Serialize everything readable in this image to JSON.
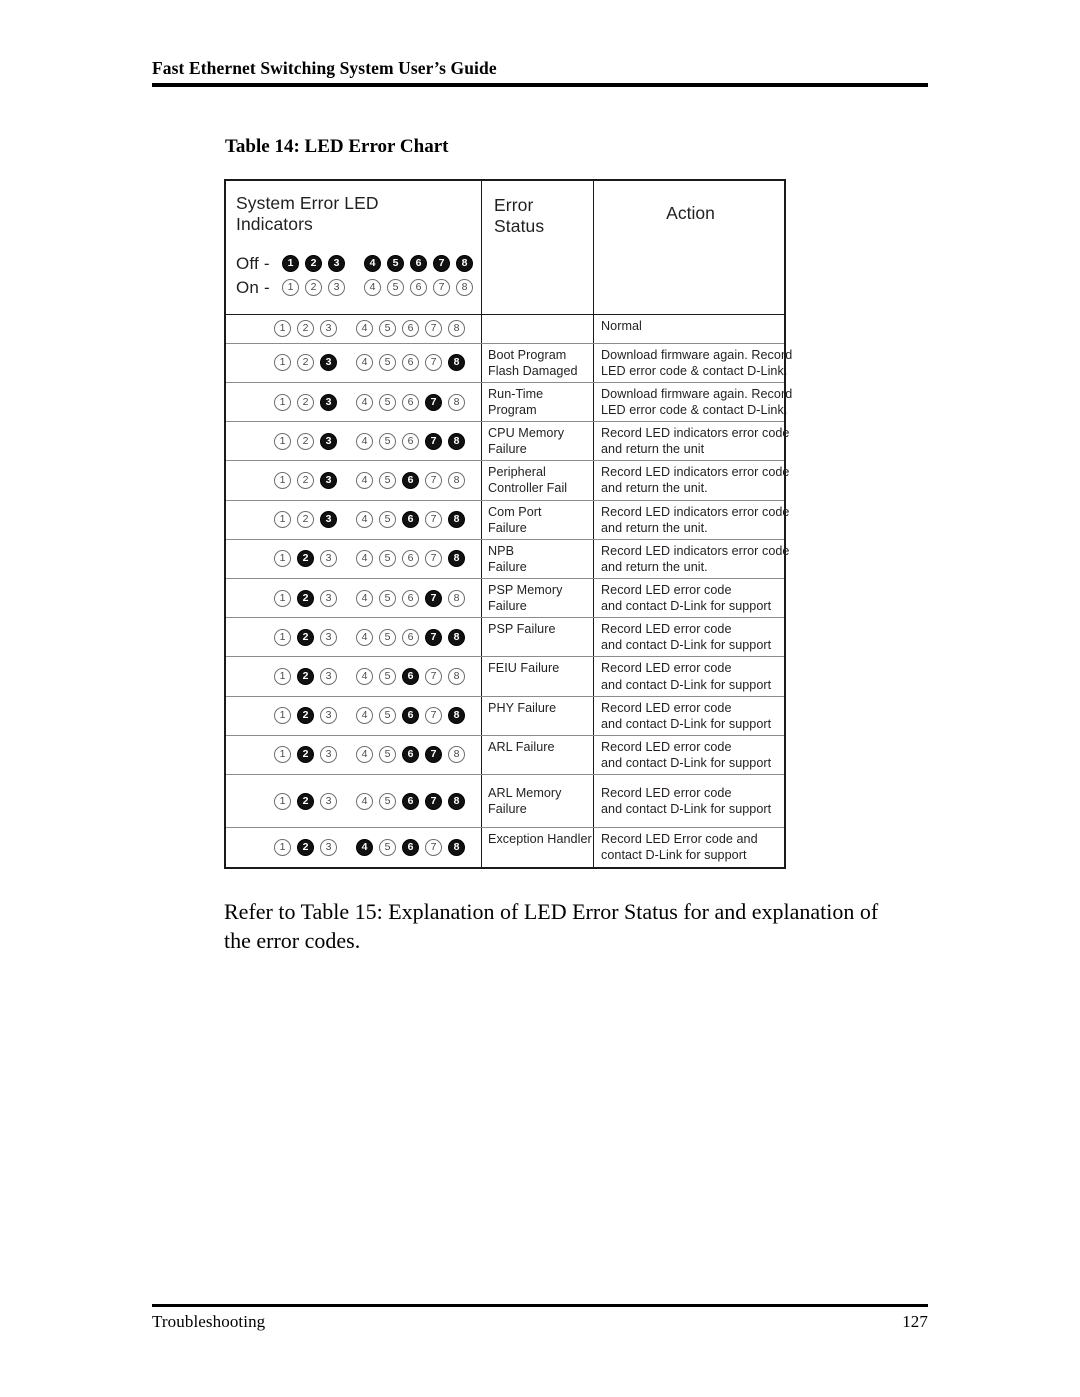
{
  "running_header": {
    "title": "Fast Ethernet Switching System User’s Guide"
  },
  "caption": {
    "label": "Table 14:",
    "text": "LED Error Chart",
    "full": "Table 14: LED Error Chart"
  },
  "chart_data": {
    "type": "table",
    "title": "Table 14: LED Error Chart",
    "legend": {
      "off_label": "Off -",
      "on_label": "On -",
      "off_state_name": "off",
      "on_state_name": "on",
      "led_numbers": [
        1,
        2,
        3,
        4,
        5,
        6,
        7,
        8
      ]
    },
    "columns": [
      "System Error LED Indicators",
      "Error Status",
      "Action"
    ],
    "column_header_lines": {
      "leds": [
        "System Error LED",
        "Indicators"
      ],
      "status": [
        "Error",
        "Status"
      ],
      "action": [
        "Action"
      ]
    },
    "note": "leds array lists the state of indicators 1-8 in order; 'off' renders as a filled black circle, 'on' as an outlined white circle.",
    "rows": [
      {
        "leds": [
          "on",
          "on",
          "on",
          "on",
          "on",
          "on",
          "on",
          "on"
        ],
        "status": [],
        "action": [
          "Normal"
        ]
      },
      {
        "leds": [
          "on",
          "on",
          "off",
          "on",
          "on",
          "on",
          "on",
          "off"
        ],
        "status": [
          "Boot Program",
          "Flash Damaged"
        ],
        "action": [
          "Download firmware again. Record",
          "LED error code & contact D-Link."
        ]
      },
      {
        "leds": [
          "on",
          "on",
          "off",
          "on",
          "on",
          "on",
          "off",
          "on"
        ],
        "status": [
          "Run-Time",
          "Program"
        ],
        "action": [
          "Download firmware again. Record",
          "LED error code & contact D-Link."
        ]
      },
      {
        "leds": [
          "on",
          "on",
          "off",
          "on",
          "on",
          "on",
          "off",
          "off"
        ],
        "status": [
          "CPU Memory",
          "Failure"
        ],
        "action": [
          "Record LED indicators error code",
          "and return the unit"
        ]
      },
      {
        "leds": [
          "on",
          "on",
          "off",
          "on",
          "on",
          "off",
          "on",
          "on"
        ],
        "status": [
          "Peripheral",
          "Controller Fail"
        ],
        "action": [
          "Record LED indicators error code",
          "and return the unit."
        ]
      },
      {
        "leds": [
          "on",
          "on",
          "off",
          "on",
          "on",
          "off",
          "on",
          "off"
        ],
        "status": [
          "Com Port",
          "Failure"
        ],
        "action": [
          "Record LED indicators error code",
          "and return the unit."
        ]
      },
      {
        "leds": [
          "on",
          "off",
          "on",
          "on",
          "on",
          "on",
          "on",
          "off"
        ],
        "status": [
          "NPB",
          "Failure"
        ],
        "action": [
          "Record LED indicators error code",
          "and return the unit."
        ]
      },
      {
        "leds": [
          "on",
          "off",
          "on",
          "on",
          "on",
          "on",
          "off",
          "on"
        ],
        "status": [
          "PSP Memory",
          "Failure"
        ],
        "action": [
          "Record LED error code",
          "and contact D-Link for support"
        ]
      },
      {
        "leds": [
          "on",
          "off",
          "on",
          "on",
          "on",
          "on",
          "off",
          "off"
        ],
        "status": [
          "PSP Failure"
        ],
        "action": [
          "Record LED error code",
          "and contact D-Link for support"
        ]
      },
      {
        "leds": [
          "on",
          "off",
          "on",
          "on",
          "on",
          "off",
          "on",
          "on"
        ],
        "status": [
          "FEIU Failure"
        ],
        "action": [
          "Record LED error code",
          "and contact D-Link for support"
        ]
      },
      {
        "leds": [
          "on",
          "off",
          "on",
          "on",
          "on",
          "off",
          "on",
          "off"
        ],
        "status": [
          "PHY Failure"
        ],
        "action": [
          "Record LED error code",
          "and contact D-Link for support"
        ]
      },
      {
        "leds": [
          "on",
          "off",
          "on",
          "on",
          "on",
          "off",
          "off",
          "on"
        ],
        "status": [
          "ARL Failure"
        ],
        "action": [
          "Record LED error code",
          "and contact D-Link for support"
        ]
      },
      {
        "leds": [
          "on",
          "off",
          "on",
          "on",
          "on",
          "off",
          "off",
          "off"
        ],
        "status": [
          "ARL Memory",
          "Failure"
        ],
        "action": [
          "Record LED error code",
          "and contact D-Link for support"
        ]
      },
      {
        "leds": [
          "on",
          "off",
          "on",
          "off",
          "on",
          "off",
          "on",
          "off"
        ],
        "status": [
          "Exception Handler"
        ],
        "action": [
          "Record LED Error code and",
          "contact D-Link for support"
        ]
      }
    ]
  },
  "body": {
    "paragraph": "Refer to Table 15: Explanation of LED Error Status for and explanation of the error codes."
  },
  "footer": {
    "section": "Troubleshooting",
    "page_number": "127"
  }
}
